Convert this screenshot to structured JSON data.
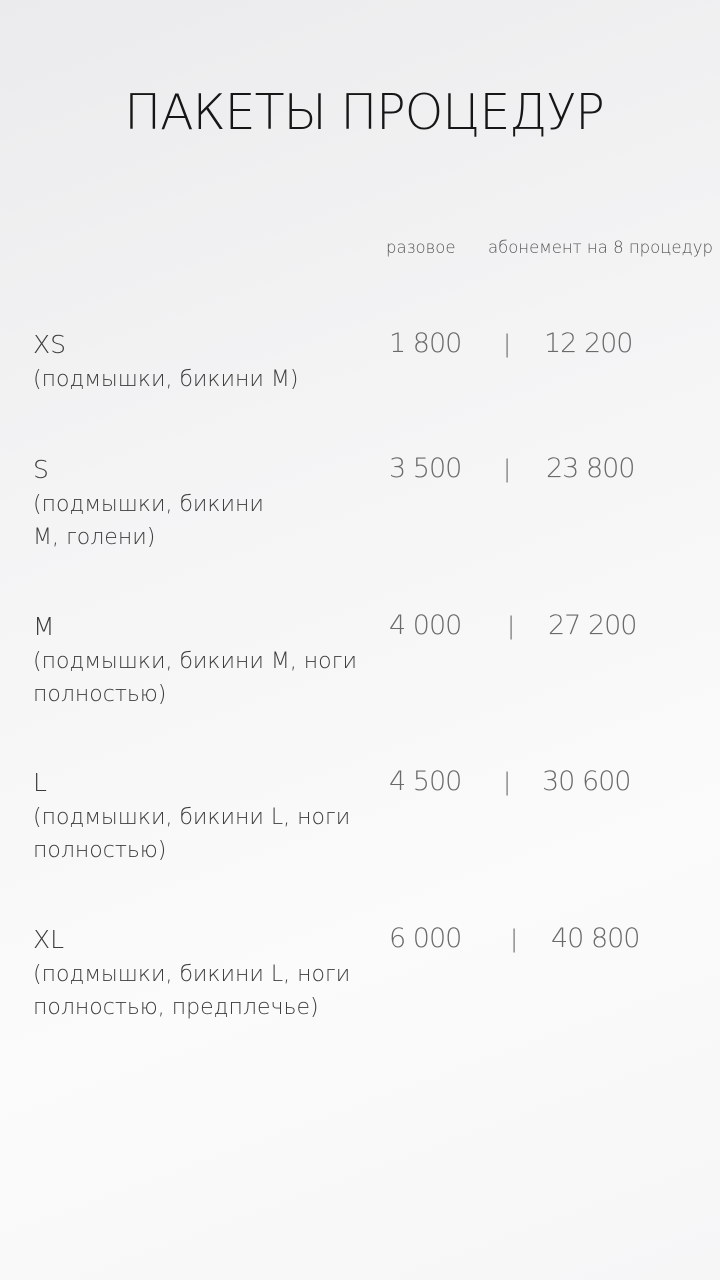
{
  "title": "ПАКЕТЫ ПРОЦЕДУР",
  "columns": {
    "single": "разовое",
    "subscription": "абонемент на 8 процедур"
  },
  "separator": "|",
  "packages": [
    {
      "name": "XS",
      "description": "(подмышки, бикини М)",
      "single_price": "1 800",
      "subscription_price": "12 200"
    },
    {
      "name": "S",
      "description": "(подмышки, бикини М, голени)",
      "single_price": "3 500",
      "subscription_price": "23 800"
    },
    {
      "name": "M",
      "description": "(подмышки, бикини М, ноги полностью)",
      "single_price": "4 000",
      "subscription_price": "27 200"
    },
    {
      "name": "L",
      "description": "(подмышки, бикини L, ноги полностью)",
      "single_price": "4 500",
      "subscription_price": "30 600"
    },
    {
      "name": "XL",
      "description": "(подмышки, бикини L, ноги полностью, предплечье)",
      "single_price": "6 000",
      "subscription_price": "40 800"
    }
  ]
}
